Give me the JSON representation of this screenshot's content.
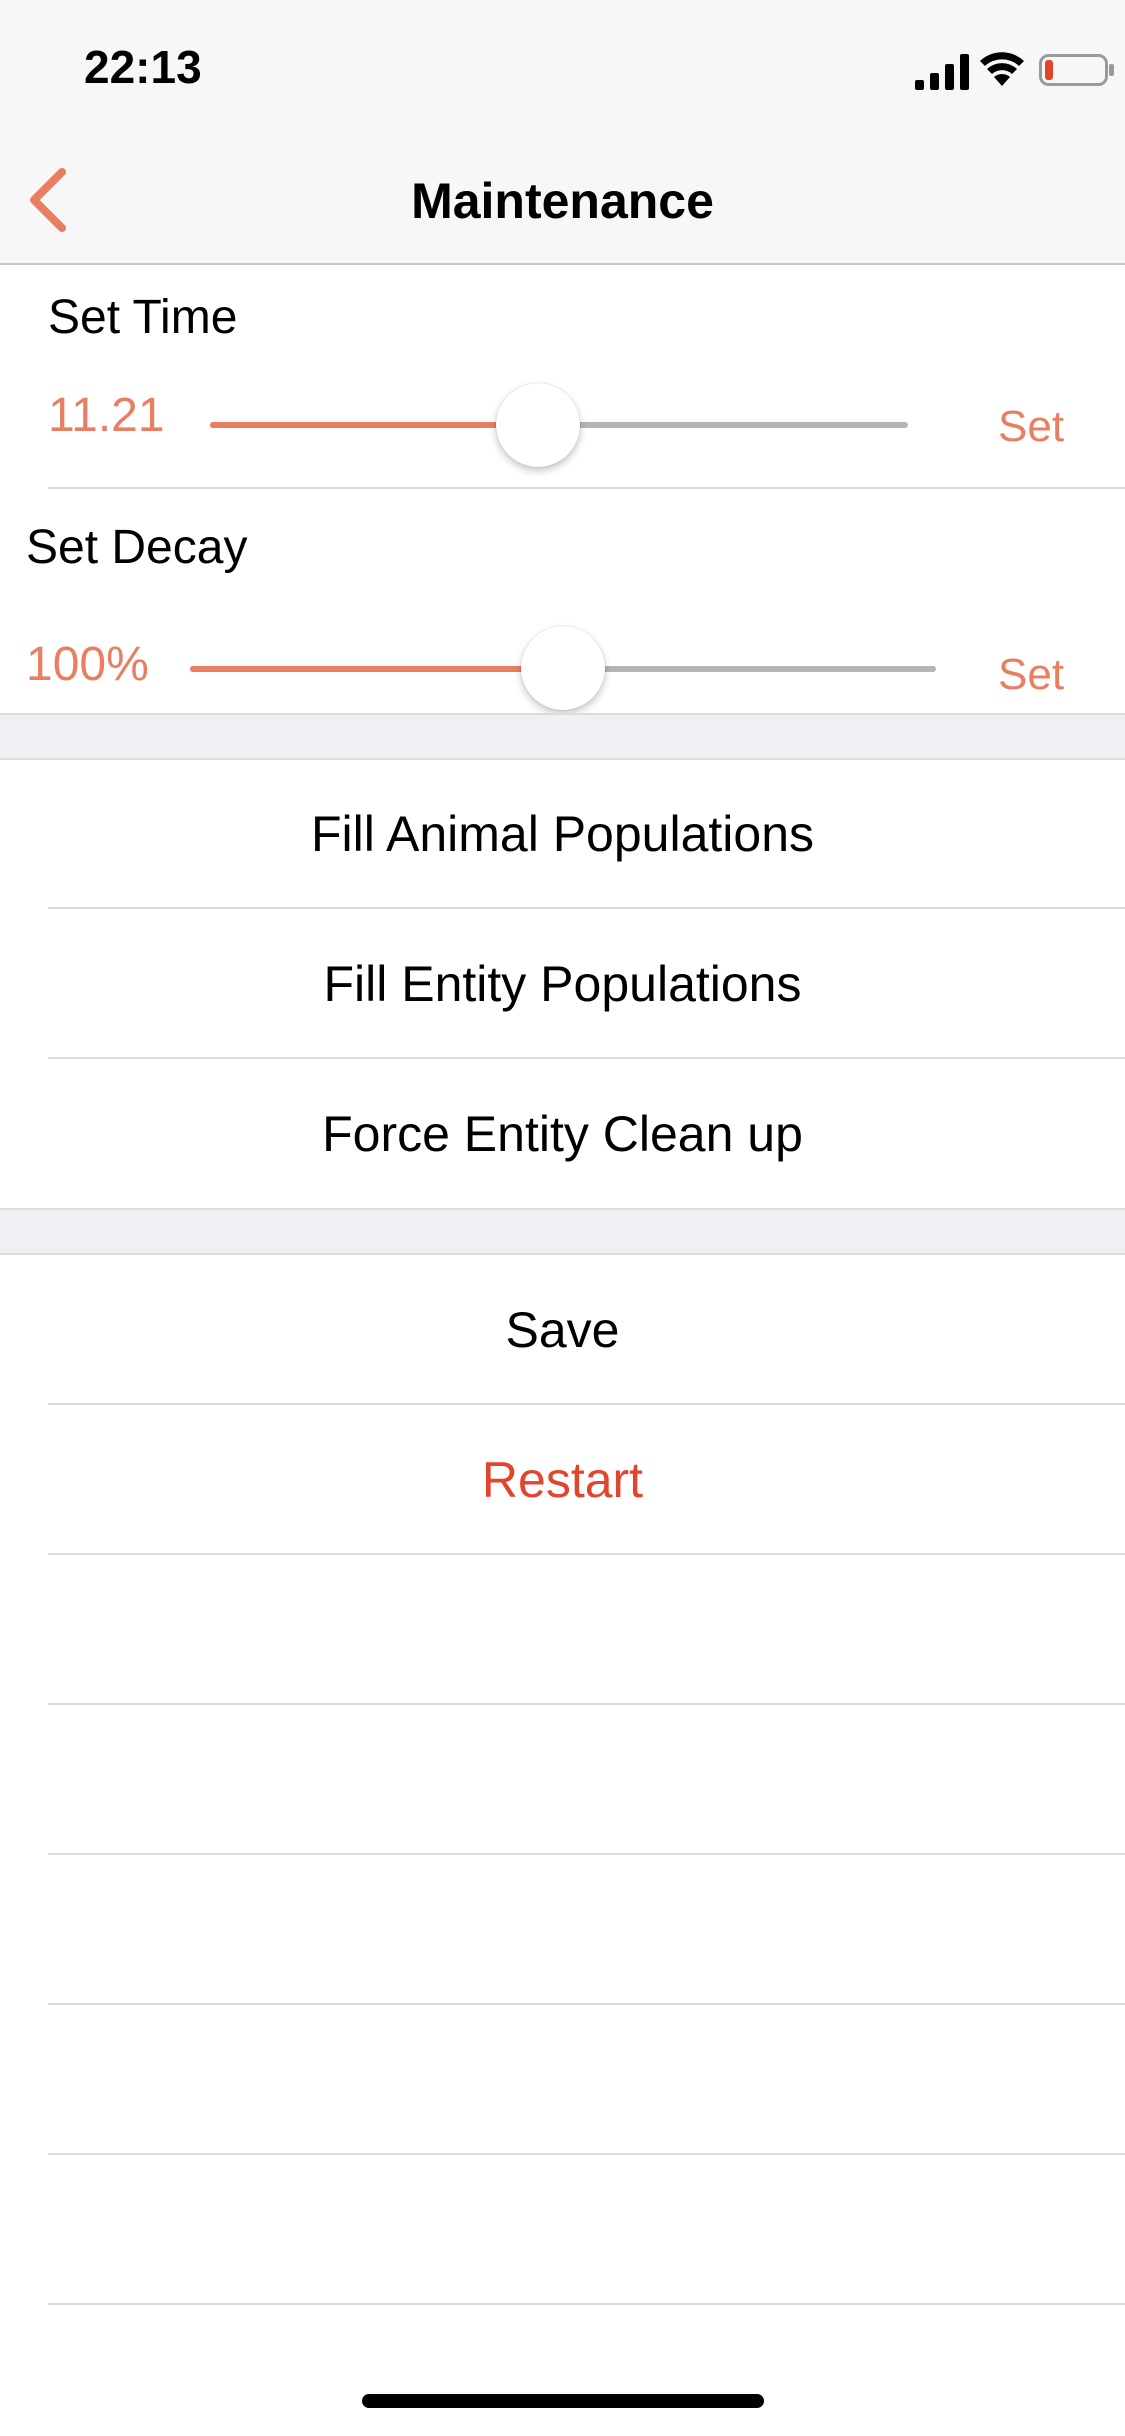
{
  "status_bar": {
    "time": "22:13",
    "icons": [
      "signal-icon",
      "wifi-icon",
      "battery-low-icon"
    ]
  },
  "nav": {
    "title": "Maintenance",
    "back_icon": "chevron-left-icon"
  },
  "time_slider": {
    "label": "Set Time",
    "value": "11.21",
    "position": 0.47,
    "set_label": "Set"
  },
  "decay_slider": {
    "label": "Set Decay",
    "value": "100%",
    "position": 0.5,
    "set_label": "Set"
  },
  "actions": {
    "fill_animal": "Fill Animal Populations",
    "fill_entity": "Fill Entity Populations",
    "force_cleanup": "Force Entity Clean up",
    "save": "Save",
    "restart": "Restart"
  },
  "colors": {
    "accent": "#e97f62",
    "destructive": "#e3442c",
    "group_gap": "#efeff4"
  }
}
